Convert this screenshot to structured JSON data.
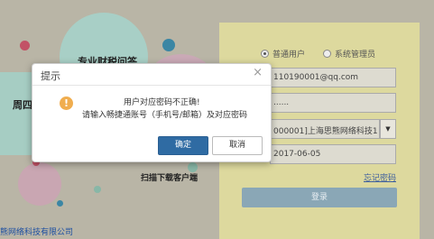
{
  "background": {
    "tax_service_label": "专业财税问答",
    "week_label": "周四",
    "scan_download_label": "扫描下载客户端",
    "company_footer": "熊网络科技有限公司"
  },
  "login": {
    "role_options": [
      "普通用户",
      "系统管理员"
    ],
    "selected_role": "普通用户",
    "email_value": "110190001@qq.com",
    "password_value": "......",
    "company_value": "000001]上海思熊网络科技1",
    "date_value": "2017-06-05",
    "forgot_label": "忘记密码",
    "login_label": "登录"
  },
  "dialog": {
    "title": "提示",
    "close_glyph": "×",
    "message_line1": "用户对应密码不正确!",
    "message_line2": "请输入畅捷通账号（手机号/邮箱）及对应密码",
    "ok_label": "确定",
    "cancel_label": "取消"
  },
  "colors": {
    "overlay": "#b9b5a6",
    "panel": "#ddd99e",
    "primary": "#2f6ba3",
    "warning": "#f0ad4e"
  }
}
